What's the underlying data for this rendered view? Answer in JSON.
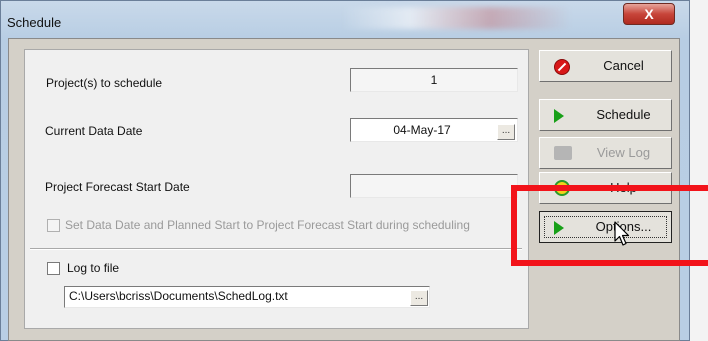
{
  "window": {
    "title": "Schedule",
    "close_glyph": "X"
  },
  "form": {
    "projects_label": "Project(s) to schedule",
    "projects_value": "1",
    "data_date_label": "Current Data Date",
    "data_date_value": "04-May-17",
    "forecast_label": "Project Forecast Start Date",
    "forecast_value": "",
    "set_data_date_label": "Set Data Date and Planned Start to Project Forecast Start during scheduling",
    "log_to_file_label": "Log to file",
    "log_path": "C:\\Users\\bcriss\\Documents\\SchedLog.txt",
    "ellipsis": "..."
  },
  "buttons": {
    "cancel": "Cancel",
    "schedule": "Schedule",
    "view_log": "View Log",
    "help": "Help",
    "options": "Options..."
  },
  "icons": {
    "cancel": "cancel-icon",
    "schedule": "play-icon",
    "view_log": "log-icon",
    "help": "help-icon",
    "options": "play-icon"
  },
  "colors": {
    "annotation": "#f2131a",
    "accent_green": "#18a018",
    "cancel_red": "#d81818"
  }
}
